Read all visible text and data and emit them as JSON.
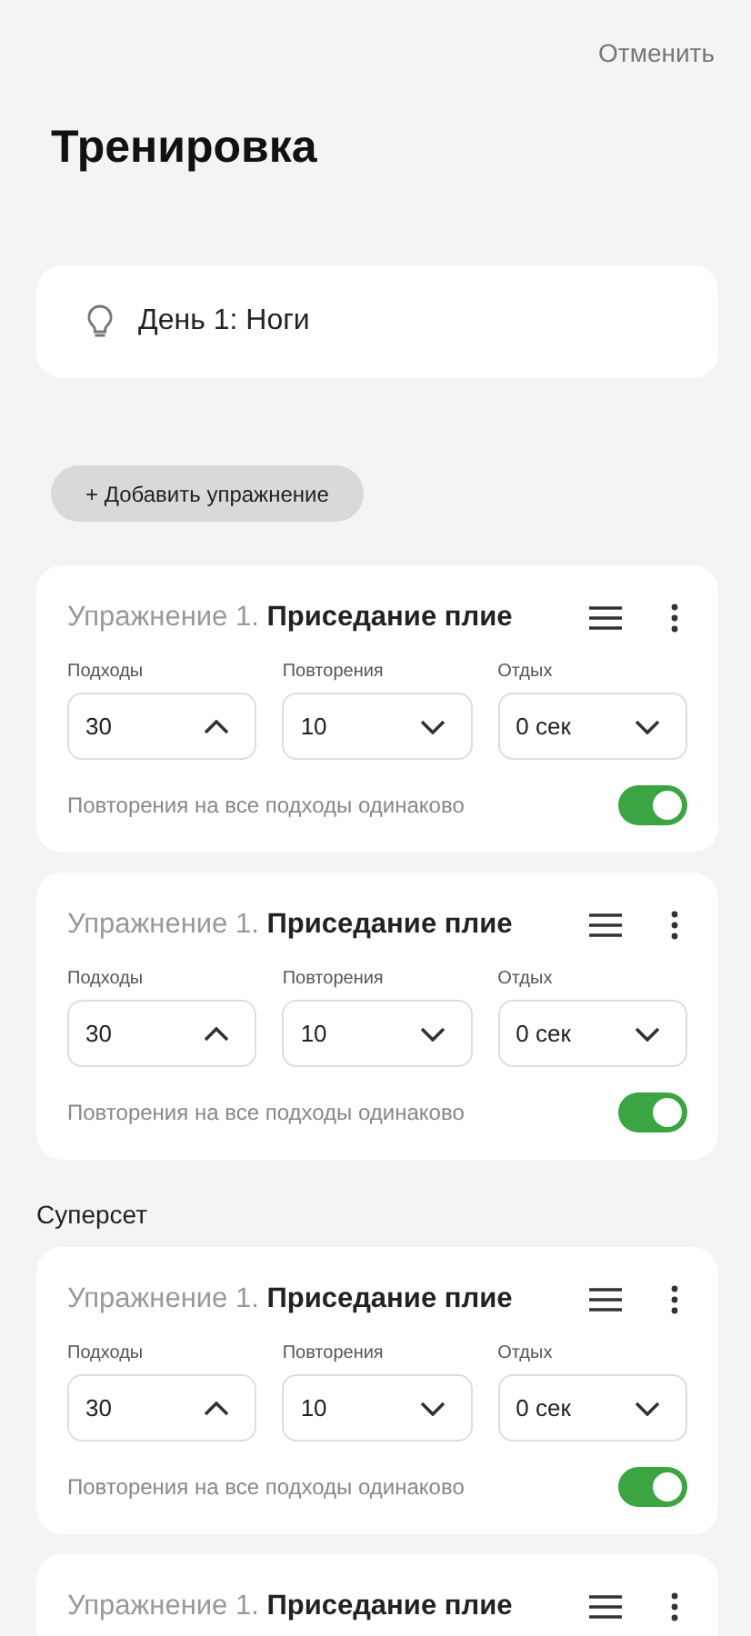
{
  "cancel": "Отменить",
  "title": "Тренировка",
  "day": {
    "label": "День 1: Ноги"
  },
  "add_button": "+ Добавить упражнение",
  "blocks": [
    {
      "kind": "exercise",
      "number": "Упражнение 1.",
      "name": "Приседание плие",
      "fields": [
        {
          "label": "Подходы",
          "value": "30",
          "expanded": true
        },
        {
          "label": "Повторения",
          "value": "10",
          "expanded": false
        },
        {
          "label": "Отдых",
          "value": "0 сек",
          "expanded": false
        }
      ],
      "toggle": {
        "label": "Повторения на все подходы одинаково",
        "on": true
      }
    },
    {
      "kind": "exercise",
      "number": "Упражнение 1.",
      "name": "Приседание плие",
      "fields": [
        {
          "label": "Подходы",
          "value": "30",
          "expanded": true
        },
        {
          "label": "Повторения",
          "value": "10",
          "expanded": false
        },
        {
          "label": "Отдых",
          "value": "0 сек",
          "expanded": false
        }
      ],
      "toggle": {
        "label": "Повторения на все подходы одинаково",
        "on": true
      }
    },
    {
      "kind": "heading",
      "text": "Суперсет"
    },
    {
      "kind": "exercise",
      "number": "Упражнение 1.",
      "name": "Приседание плие",
      "fields": [
        {
          "label": "Подходы",
          "value": "30",
          "expanded": true
        },
        {
          "label": "Повторения",
          "value": "10",
          "expanded": false
        },
        {
          "label": "Отдых",
          "value": "0 сек",
          "expanded": false
        }
      ],
      "toggle": {
        "label": "Повторения на все подходы одинаково",
        "on": true
      }
    },
    {
      "kind": "exercise",
      "number": "Упражнение 1.",
      "name": "Приседание плие"
    }
  ]
}
